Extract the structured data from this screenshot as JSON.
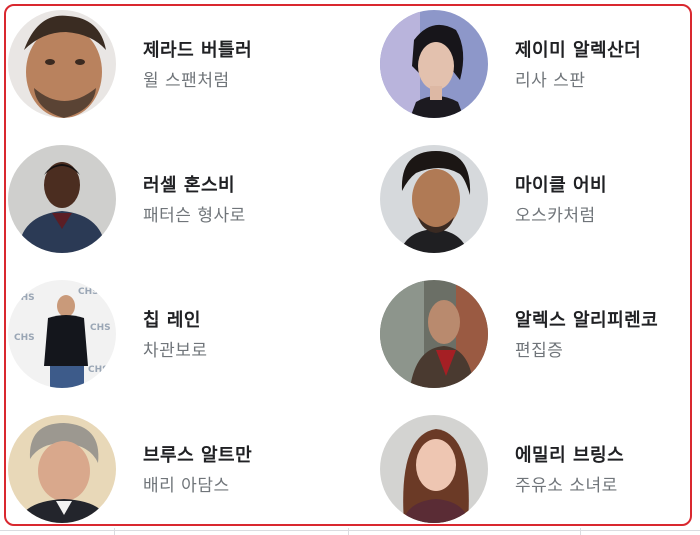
{
  "cast": [
    {
      "name": "제라드 버틀러",
      "role": "윌 스팬처럼"
    },
    {
      "name": "제이미 알렉산더",
      "role": "리사 스판"
    },
    {
      "name": "러셀 혼스비",
      "role": "패터슨 형사로"
    },
    {
      "name": "마이클 어비",
      "role": "오스카처럼"
    },
    {
      "name": "칩 레인",
      "role": "차관보로"
    },
    {
      "name": "알렉스 알리피렌코",
      "role": "편집증"
    },
    {
      "name": "브루스 알트만",
      "role": "배리 아담스"
    },
    {
      "name": "에밀리 브링스",
      "role": "주유소 소녀로"
    }
  ],
  "colors": {
    "frame_border": "#d9282f",
    "name_text": "#202124",
    "role_text": "#70757a"
  }
}
